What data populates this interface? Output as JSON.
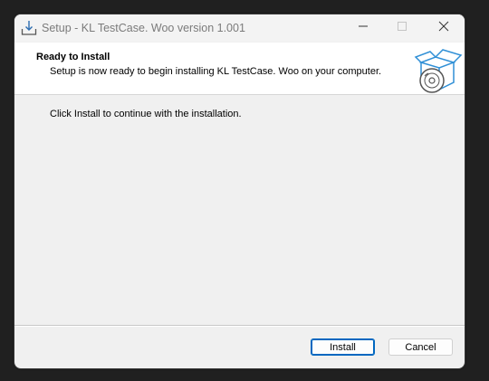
{
  "window": {
    "title": "Setup - KL TestCase. Woo version 1.001",
    "icon": "download-tray-icon",
    "controls": [
      "minimize-icon",
      "maximize-icon",
      "close-icon"
    ]
  },
  "header": {
    "title": "Ready to Install",
    "subtitle": "Setup is now ready to begin installing KL TestCase. Woo on your computer.",
    "graphic": "installer-box-disc-icon"
  },
  "main": {
    "message": "Click Install to continue with the installation."
  },
  "buttons": {
    "install_label": "Install",
    "cancel_label": "Cancel"
  },
  "colors": {
    "accent": "#0067c0",
    "box_icon": "#2f8fd6"
  }
}
